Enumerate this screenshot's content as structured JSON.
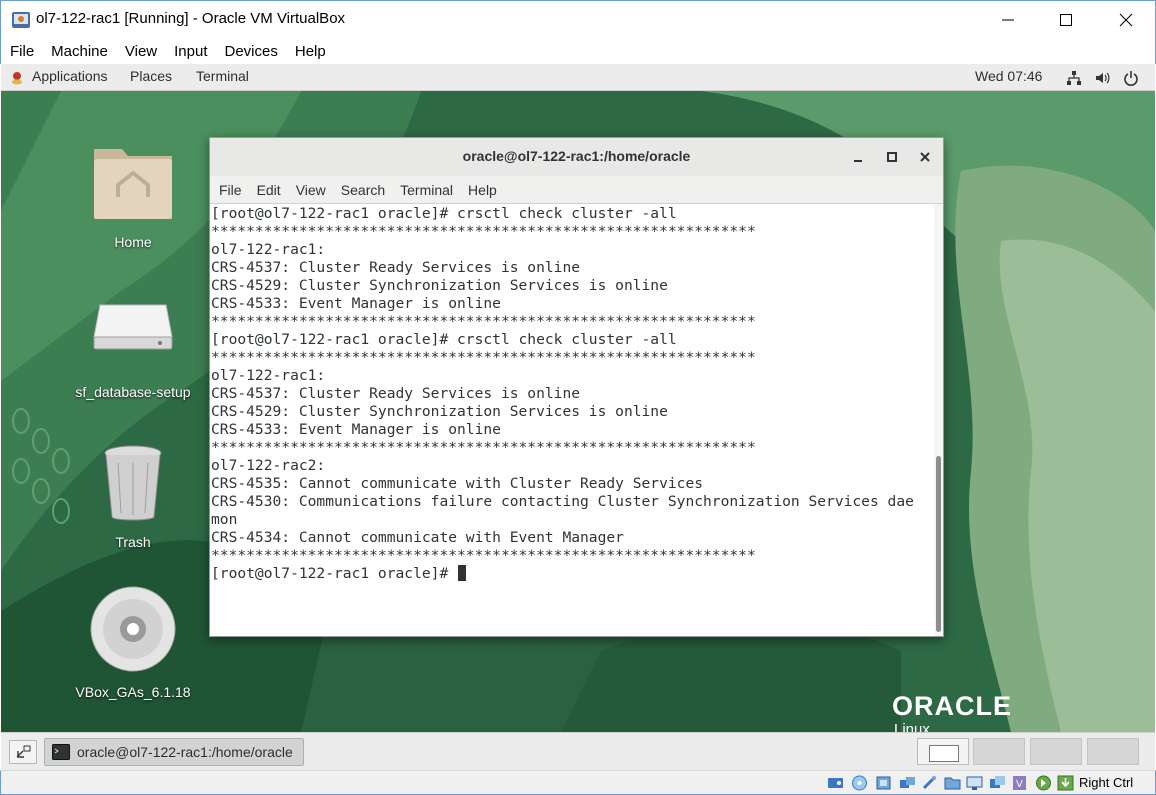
{
  "vbox": {
    "title": "ol7-122-rac1 [Running] - Oracle VM VirtualBox",
    "menu": [
      "File",
      "Machine",
      "View",
      "Input",
      "Devices",
      "Help"
    ],
    "host_key": "Right Ctrl"
  },
  "gnome_topbar": {
    "applications": "Applications",
    "places": "Places",
    "terminal": "Terminal",
    "clock": "Wed 07:46"
  },
  "desktop": {
    "icons": [
      {
        "label": "Home",
        "icon": "home-folder-icon"
      },
      {
        "label": "sf_database-setup",
        "icon": "drive-icon"
      },
      {
        "label": "Trash",
        "icon": "trash-icon"
      },
      {
        "label": "VBox_GAs_6.1.18",
        "icon": "cd-icon"
      }
    ],
    "branding": {
      "logo": "ORACLE",
      "sub": "Linux"
    }
  },
  "terminal": {
    "title": "oracle@ol7-122-rac1:/home/oracle",
    "menu": [
      "File",
      "Edit",
      "View",
      "Search",
      "Terminal",
      "Help"
    ],
    "lines": [
      "[root@ol7-122-rac1 oracle]# crsctl check cluster -all",
      "**************************************************************",
      "ol7-122-rac1:",
      "CRS-4537: Cluster Ready Services is online",
      "CRS-4529: Cluster Synchronization Services is online",
      "CRS-4533: Event Manager is online",
      "**************************************************************",
      "[root@ol7-122-rac1 oracle]# crsctl check cluster -all",
      "**************************************************************",
      "ol7-122-rac1:",
      "CRS-4537: Cluster Ready Services is online",
      "CRS-4529: Cluster Synchronization Services is online",
      "CRS-4533: Event Manager is online",
      "**************************************************************",
      "ol7-122-rac2:",
      "CRS-4535: Cannot communicate with Cluster Ready Services",
      "CRS-4530: Communications failure contacting Cluster Synchronization Services dae",
      "mon",
      "CRS-4534: Cannot communicate with Event Manager",
      "**************************************************************"
    ],
    "prompt": "[root@ol7-122-rac1 oracle]# "
  },
  "bottombar": {
    "task_label": "oracle@ol7-122-rac1:/home/oracle"
  }
}
